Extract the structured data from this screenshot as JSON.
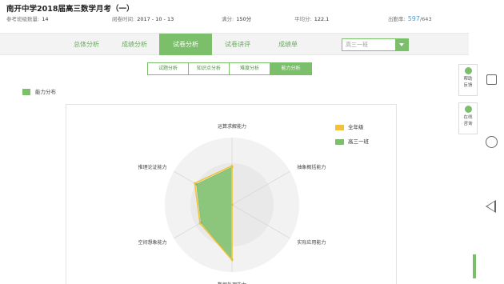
{
  "header": {
    "title": "南开中学2018届高三数学月考（一）",
    "meta": [
      {
        "label": "参考班级数量:",
        "value": "14"
      },
      {
        "label": "阅卷时间:",
        "value": "2017 - 10 - 13"
      },
      {
        "label": "满分:",
        "value": "150分"
      },
      {
        "label": "平均分:",
        "value": "122.1"
      },
      {
        "label": "出勤率:",
        "value_main": "597",
        "value_rest": "/643"
      }
    ]
  },
  "tabs": [
    {
      "label": "总体分析",
      "active": false
    },
    {
      "label": "成绩分析",
      "active": false
    },
    {
      "label": "试卷分析",
      "active": true
    },
    {
      "label": "试卷讲评",
      "active": false
    },
    {
      "label": "成绩单",
      "active": false
    }
  ],
  "class_select": {
    "value": "高三一班"
  },
  "subtabs": [
    {
      "label": "试题分析",
      "active": false
    },
    {
      "label": "知识点分析",
      "active": false
    },
    {
      "label": "难度分析",
      "active": false
    },
    {
      "label": "能力分析",
      "active": true
    }
  ],
  "section_title": "能力分布",
  "chart_data": {
    "type": "radar",
    "axes": [
      "运算求解能力",
      "抽象概括能力",
      "实际应用能力",
      "数据处理能力",
      "空间想象能力",
      "推理论证能力"
    ],
    "series": [
      {
        "name": "全年级",
        "color": "#f2c33a",
        "values": [
          0.58,
          0.0,
          0.0,
          0.82,
          0.55,
          0.64
        ]
      },
      {
        "name": "高三一班",
        "color": "#7bbf6a",
        "values": [
          0.56,
          0.0,
          0.0,
          0.81,
          0.53,
          0.61
        ]
      }
    ],
    "colors": {
      "grid_outer": "#f2f2f2",
      "grid_inner": "#e9e9e9",
      "axis": "#d8d8d8"
    }
  },
  "float_buttons": [
    {
      "label1": "帮助",
      "label2": "反馈"
    },
    {
      "label1": "在线",
      "label2": "咨询"
    }
  ]
}
